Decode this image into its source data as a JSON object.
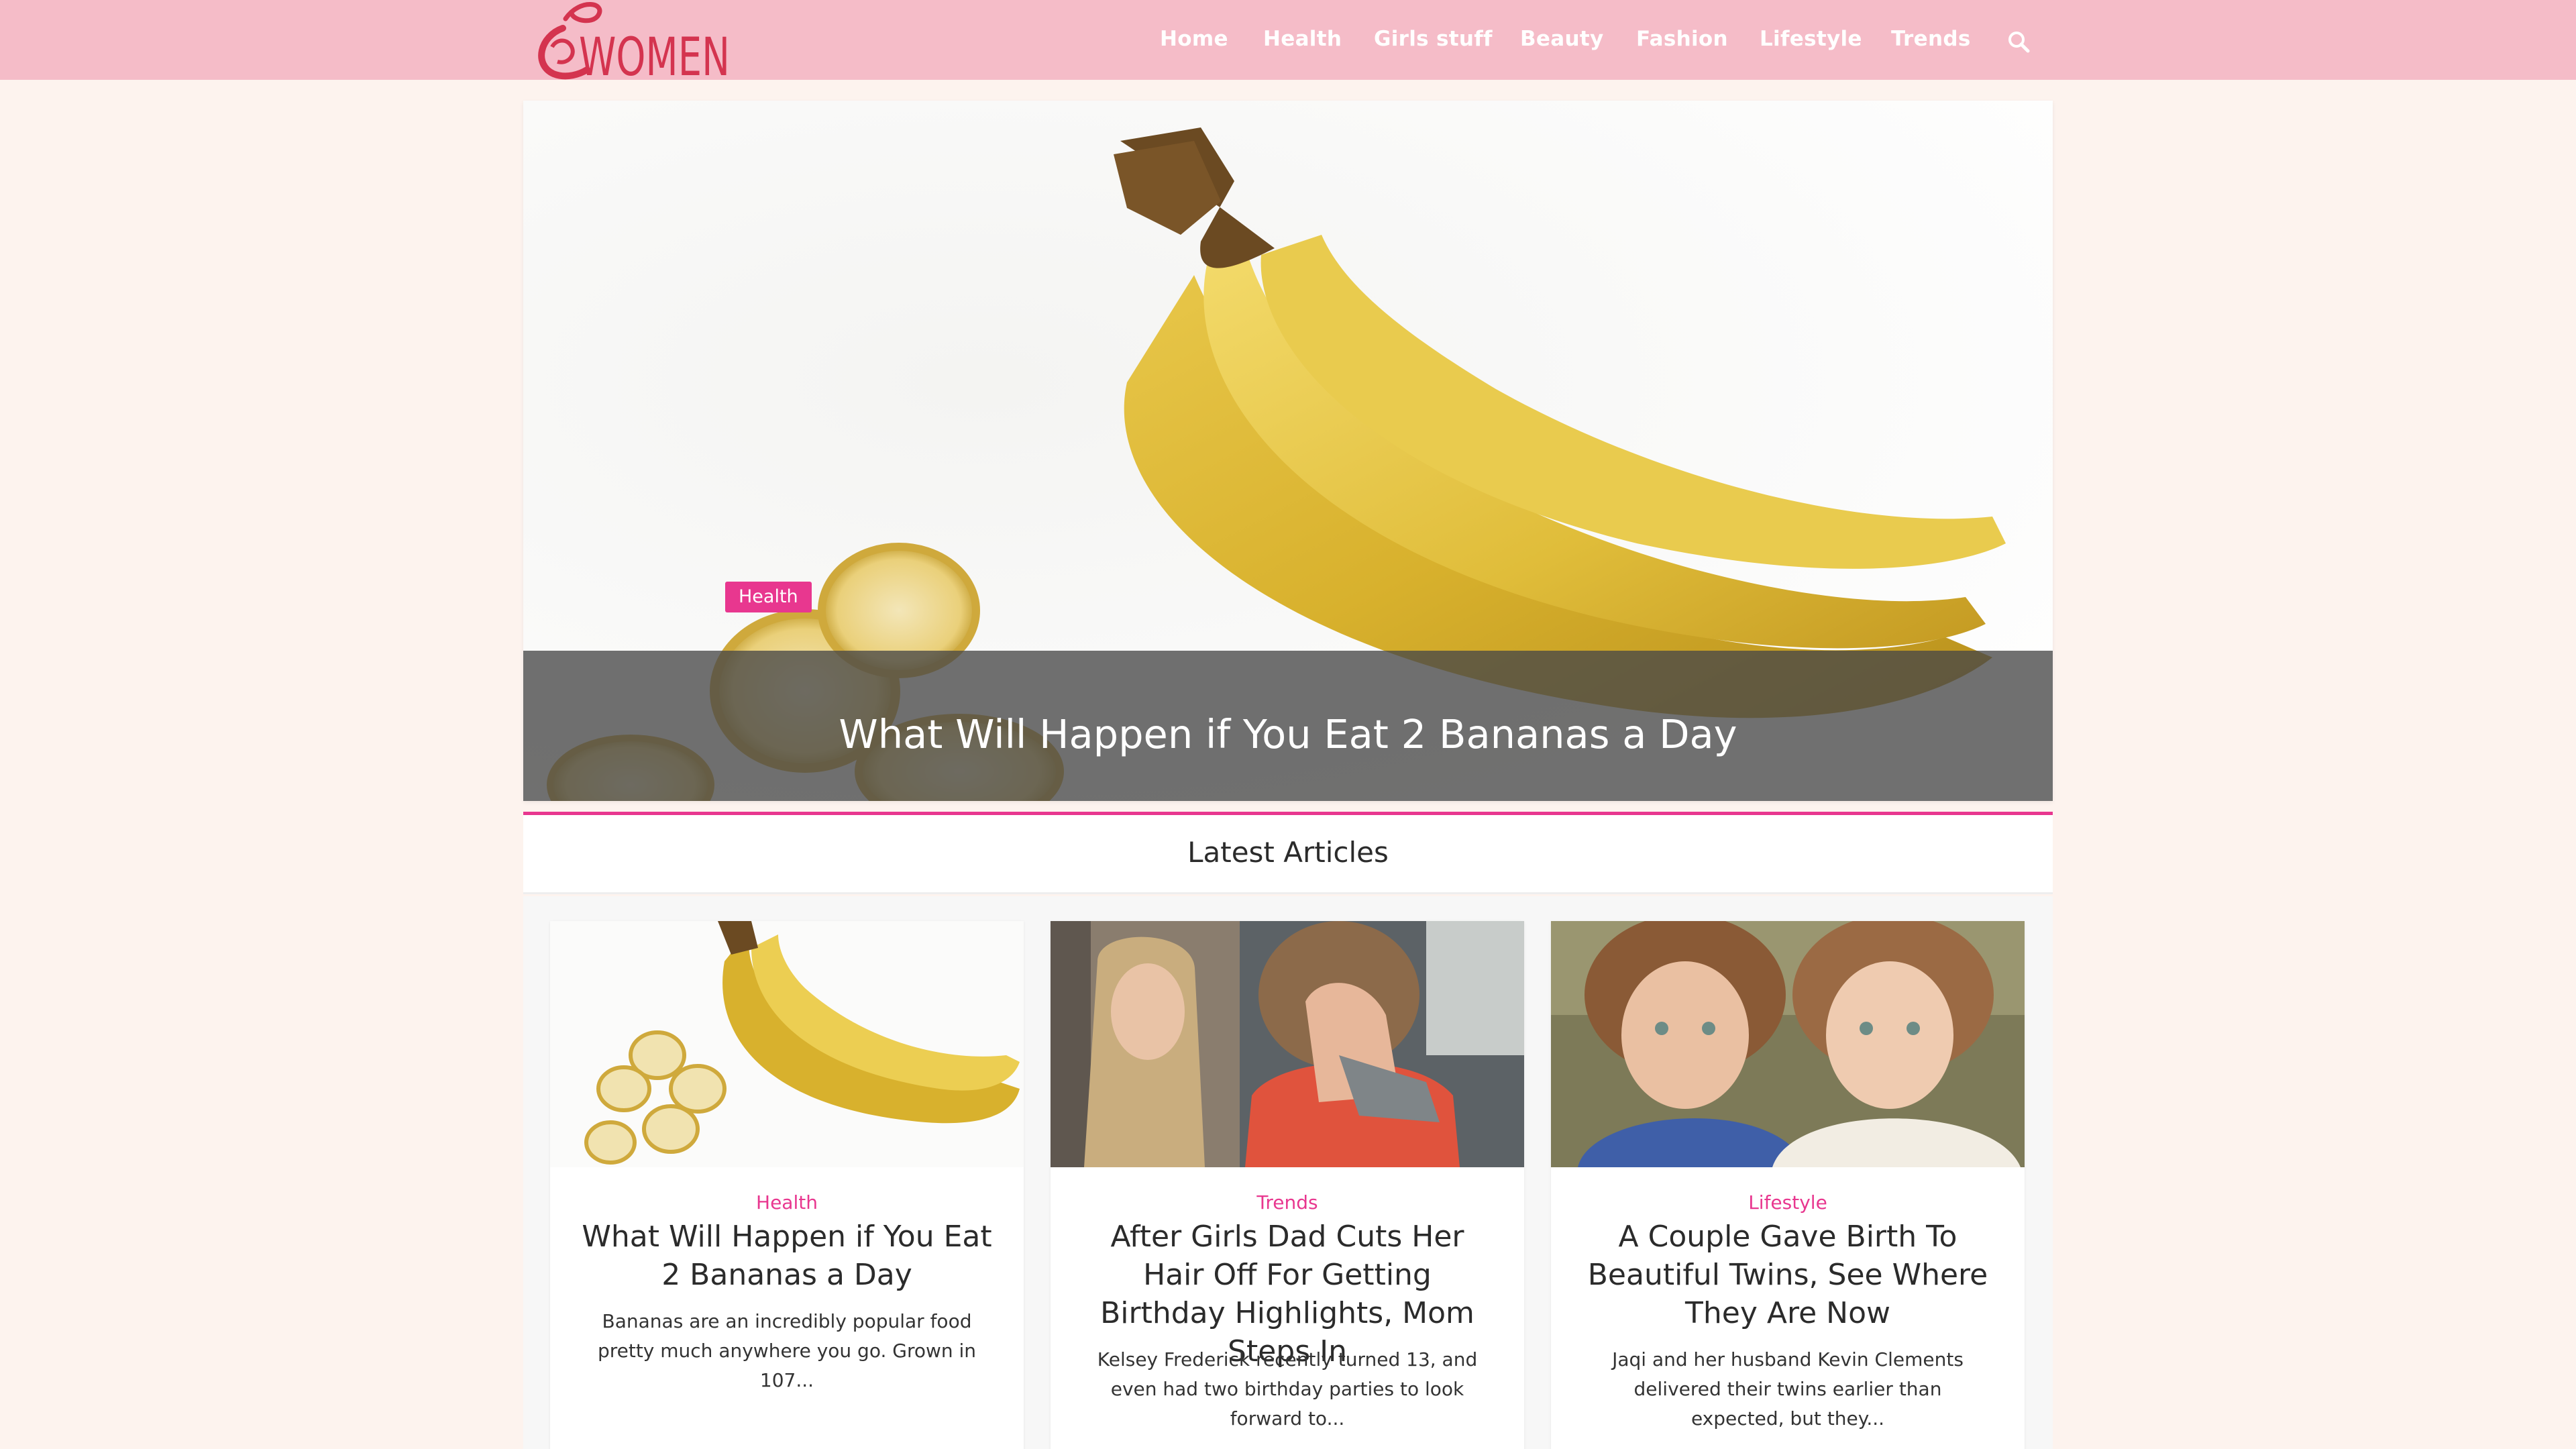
{
  "site": {
    "logo_text": "WOMEN",
    "accent_color": "#e8378f",
    "header_color": "#f5bcc8"
  },
  "nav": {
    "items": [
      "Home",
      "Health",
      "Girls stuff",
      "Beauty",
      "Fashion",
      "Lifestyle",
      "Trends"
    ],
    "search_icon": "search-icon"
  },
  "hero": {
    "category": "Health",
    "title": "What Will Happen if You Eat 2 Bananas a Day"
  },
  "latest": {
    "heading": "Latest Articles",
    "cards": [
      {
        "category": "Health",
        "title": "What Will Happen if You Eat 2 Bananas a Day",
        "excerpt": "Bananas are an incredibly popular food pretty much anywhere you go. Grown in 107..."
      },
      {
        "category": "Trends",
        "title": "After Girls Dad Cuts Her Hair Off For Getting Birthday Highlights, Mom Steps In",
        "excerpt": "Kelsey Frederick recently turned 13, and even had two birthday parties to look forward to..."
      },
      {
        "category": "Lifestyle",
        "title": "A Couple Gave Birth To Beautiful Twins, See Where They Are Now",
        "excerpt": "Jaqi and her husband Kevin Clements delivered their twins earlier than expected, but they..."
      }
    ]
  }
}
